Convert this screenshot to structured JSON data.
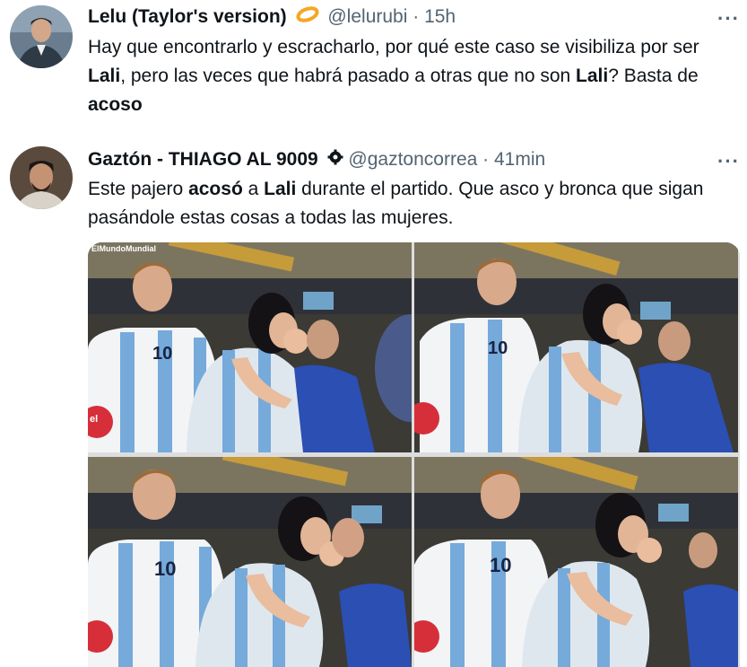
{
  "tweets": [
    {
      "display_name": "Lelu (Taylor's version)",
      "handle": "@lelurubi",
      "separator": "·",
      "time": "15h",
      "more": "···",
      "text_parts": [
        "Hay que encontrarlo y escracharlo, por qué este caso se visibiliza por ser ",
        "Lali",
        ", pero las veces que habrá pasado a otras que no son ",
        "Lali",
        "? Basta de ",
        "acoso"
      ]
    },
    {
      "display_name": "Gaztón - THIAGO AL 9009",
      "handle": "@gaztoncorrea",
      "separator": "·",
      "time": "41min",
      "more": "···",
      "text_parts": [
        "Este pajero ",
        "acosó",
        " a ",
        "Lali",
        " durante el partido. Que asco y bronca que sigan pasándole estas cosas a todas las mujeres."
      ],
      "media_watermark": "ElMundoMundial"
    }
  ],
  "colors": {
    "text": "#0f1419",
    "secondary": "#536471",
    "jersey_blue": "#75aadb",
    "badge_orange": "#f4a623"
  },
  "icons": {
    "emoji_after_name": "orange-ring-emoji",
    "badge_after_name": "verified-gear-badge"
  }
}
